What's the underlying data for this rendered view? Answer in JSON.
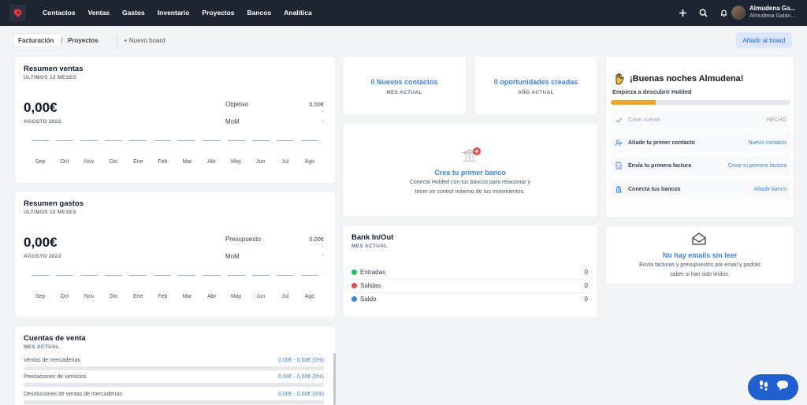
{
  "nav": {
    "items": [
      "Contactos",
      "Ventas",
      "Gastos",
      "Inventario",
      "Proyectos",
      "Bancos",
      "Analítica"
    ],
    "user_name": "Almudena Ga...",
    "user_sub": "Almudena Galán..."
  },
  "boards": {
    "active": "Facturación",
    "active_dots": "⋮",
    "second": "Proyectos",
    "new": "+ Nuevo board",
    "add": "Añadir al board"
  },
  "sales": {
    "title": "Resumen ventas",
    "subtitle": "ÚLTIMOS 12 MESES",
    "amount": "0,00€",
    "period": "AGOSTO 2022",
    "k1": "Objetivo",
    "v1": "0,00€",
    "d1": "-",
    "k2": "MoM",
    "d2": "-",
    "months": [
      "Sep",
      "Oct",
      "Nov",
      "Dic",
      "Ene",
      "Feb",
      "Mar",
      "Abr",
      "May",
      "Jun",
      "Jul",
      "Ago"
    ]
  },
  "expenses": {
    "title": "Resumen gastos",
    "subtitle": "ÚLTIMOS 12 MESES",
    "amount": "0,00€",
    "period": "AGOSTO 2022",
    "k1": "Presupuesto",
    "v1": "0,00€",
    "d1": "-",
    "k2": "MoM",
    "d2": "-",
    "months": [
      "Sep",
      "Oct",
      "Nov",
      "Dic",
      "Ene",
      "Feb",
      "Mar",
      "Abr",
      "May",
      "Jun",
      "Jul",
      "Ago"
    ]
  },
  "accounts": {
    "title": "Cuentas de venta",
    "subtitle": "MES ACTUAL",
    "rows": [
      {
        "label": "Ventas de mercaderías",
        "value": "0,00€ - 0,00€ (0%)"
      },
      {
        "label": "Prestaciones de servicios",
        "value": "0,00€ - 0,00€ (0%)"
      },
      {
        "label": "Devoluciones de ventas de mercaderías",
        "value": "0,00€ - 0,00€ (0%)"
      }
    ]
  },
  "contacts": {
    "title": "0 Nuevos contactos",
    "sub": "MES ACTUAL"
  },
  "opps": {
    "title": "0 oportunidades creadas",
    "sub": "AÑO ACTUAL"
  },
  "bank": {
    "title": "Crea tu primer banco",
    "desc1": "Conecta Holded con tus bancos para relacionar y",
    "desc2": "tener un control máximo de tus movimientos."
  },
  "inout": {
    "title": "Bank In/Out",
    "sub": "MES ACTUAL",
    "rows": [
      {
        "label": "Entradas",
        "value": "0",
        "color": "#22c55e"
      },
      {
        "label": "Salidas",
        "value": "0",
        "color": "#ef4444"
      },
      {
        "label": "Saldo",
        "value": "0",
        "color": "#3b82f6"
      }
    ]
  },
  "onboarding": {
    "greeting": "¡Buenas noches Almudena!",
    "discover": "Empieza a descubrir Holded",
    "progress": 0.25,
    "tasks": [
      {
        "label": "Crear cuenta",
        "action": "HECHO",
        "icon": "check-icon",
        "done": true
      },
      {
        "label": "Añade tu primer contacto",
        "action": "Nuevo contacto",
        "icon": "add-user-icon",
        "done": false
      },
      {
        "label": "Envía tu primera factura",
        "action": "Crear tu primera factura",
        "icon": "document-icon",
        "done": false
      },
      {
        "label": "Conecta tus bancos",
        "action": "Añadir banco",
        "icon": "bank-icon",
        "done": false
      }
    ]
  },
  "emails": {
    "title": "No hay emails sin leer",
    "desc1": "Envía facturas y presupuestos por email y podrás",
    "desc2": "saber si han sido leídos."
  }
}
